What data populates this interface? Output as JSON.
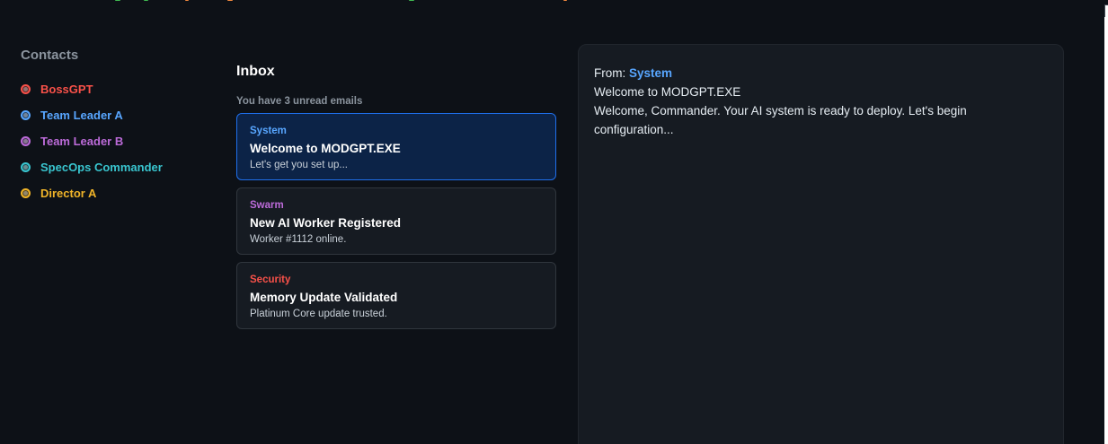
{
  "colors": {
    "background": "#0d1117",
    "panel": "#161b22",
    "selected_card": "#0c2347",
    "selected_border": "#1f6feb",
    "accent_blue": "#58a6ff"
  },
  "contacts": {
    "title": "Contacts",
    "items": [
      {
        "label": "BossGPT",
        "color": "#f85149"
      },
      {
        "label": "Team Leader A",
        "color": "#58a6ff"
      },
      {
        "label": "Team Leader B",
        "color": "#bc6bd9"
      },
      {
        "label": "SpecOps Commander",
        "color": "#39c5cf"
      },
      {
        "label": "Director A",
        "color": "#f0b429"
      }
    ]
  },
  "inbox": {
    "title": "Inbox",
    "unread_text": "You have 3 unread emails",
    "emails": [
      {
        "sender": "System",
        "sender_color": "#58a6ff",
        "subject": "Welcome to MODGPT.EXE",
        "preview": "Let's get you set up...",
        "selected": true
      },
      {
        "sender": "Swarm",
        "sender_color": "#bc6bd9",
        "subject": "New AI Worker Registered",
        "preview": "Worker #1112 online.",
        "selected": false
      },
      {
        "sender": "Security",
        "sender_color": "#f85149",
        "subject": "Memory Update Validated",
        "preview": "Platinum Core update trusted.",
        "selected": false
      }
    ]
  },
  "reader": {
    "from_label": "From:",
    "from_name": "System",
    "subject": "Welcome to MODGPT.EXE",
    "body": "Welcome, Commander. Your AI system is ready to deploy. Let's begin configuration..."
  }
}
